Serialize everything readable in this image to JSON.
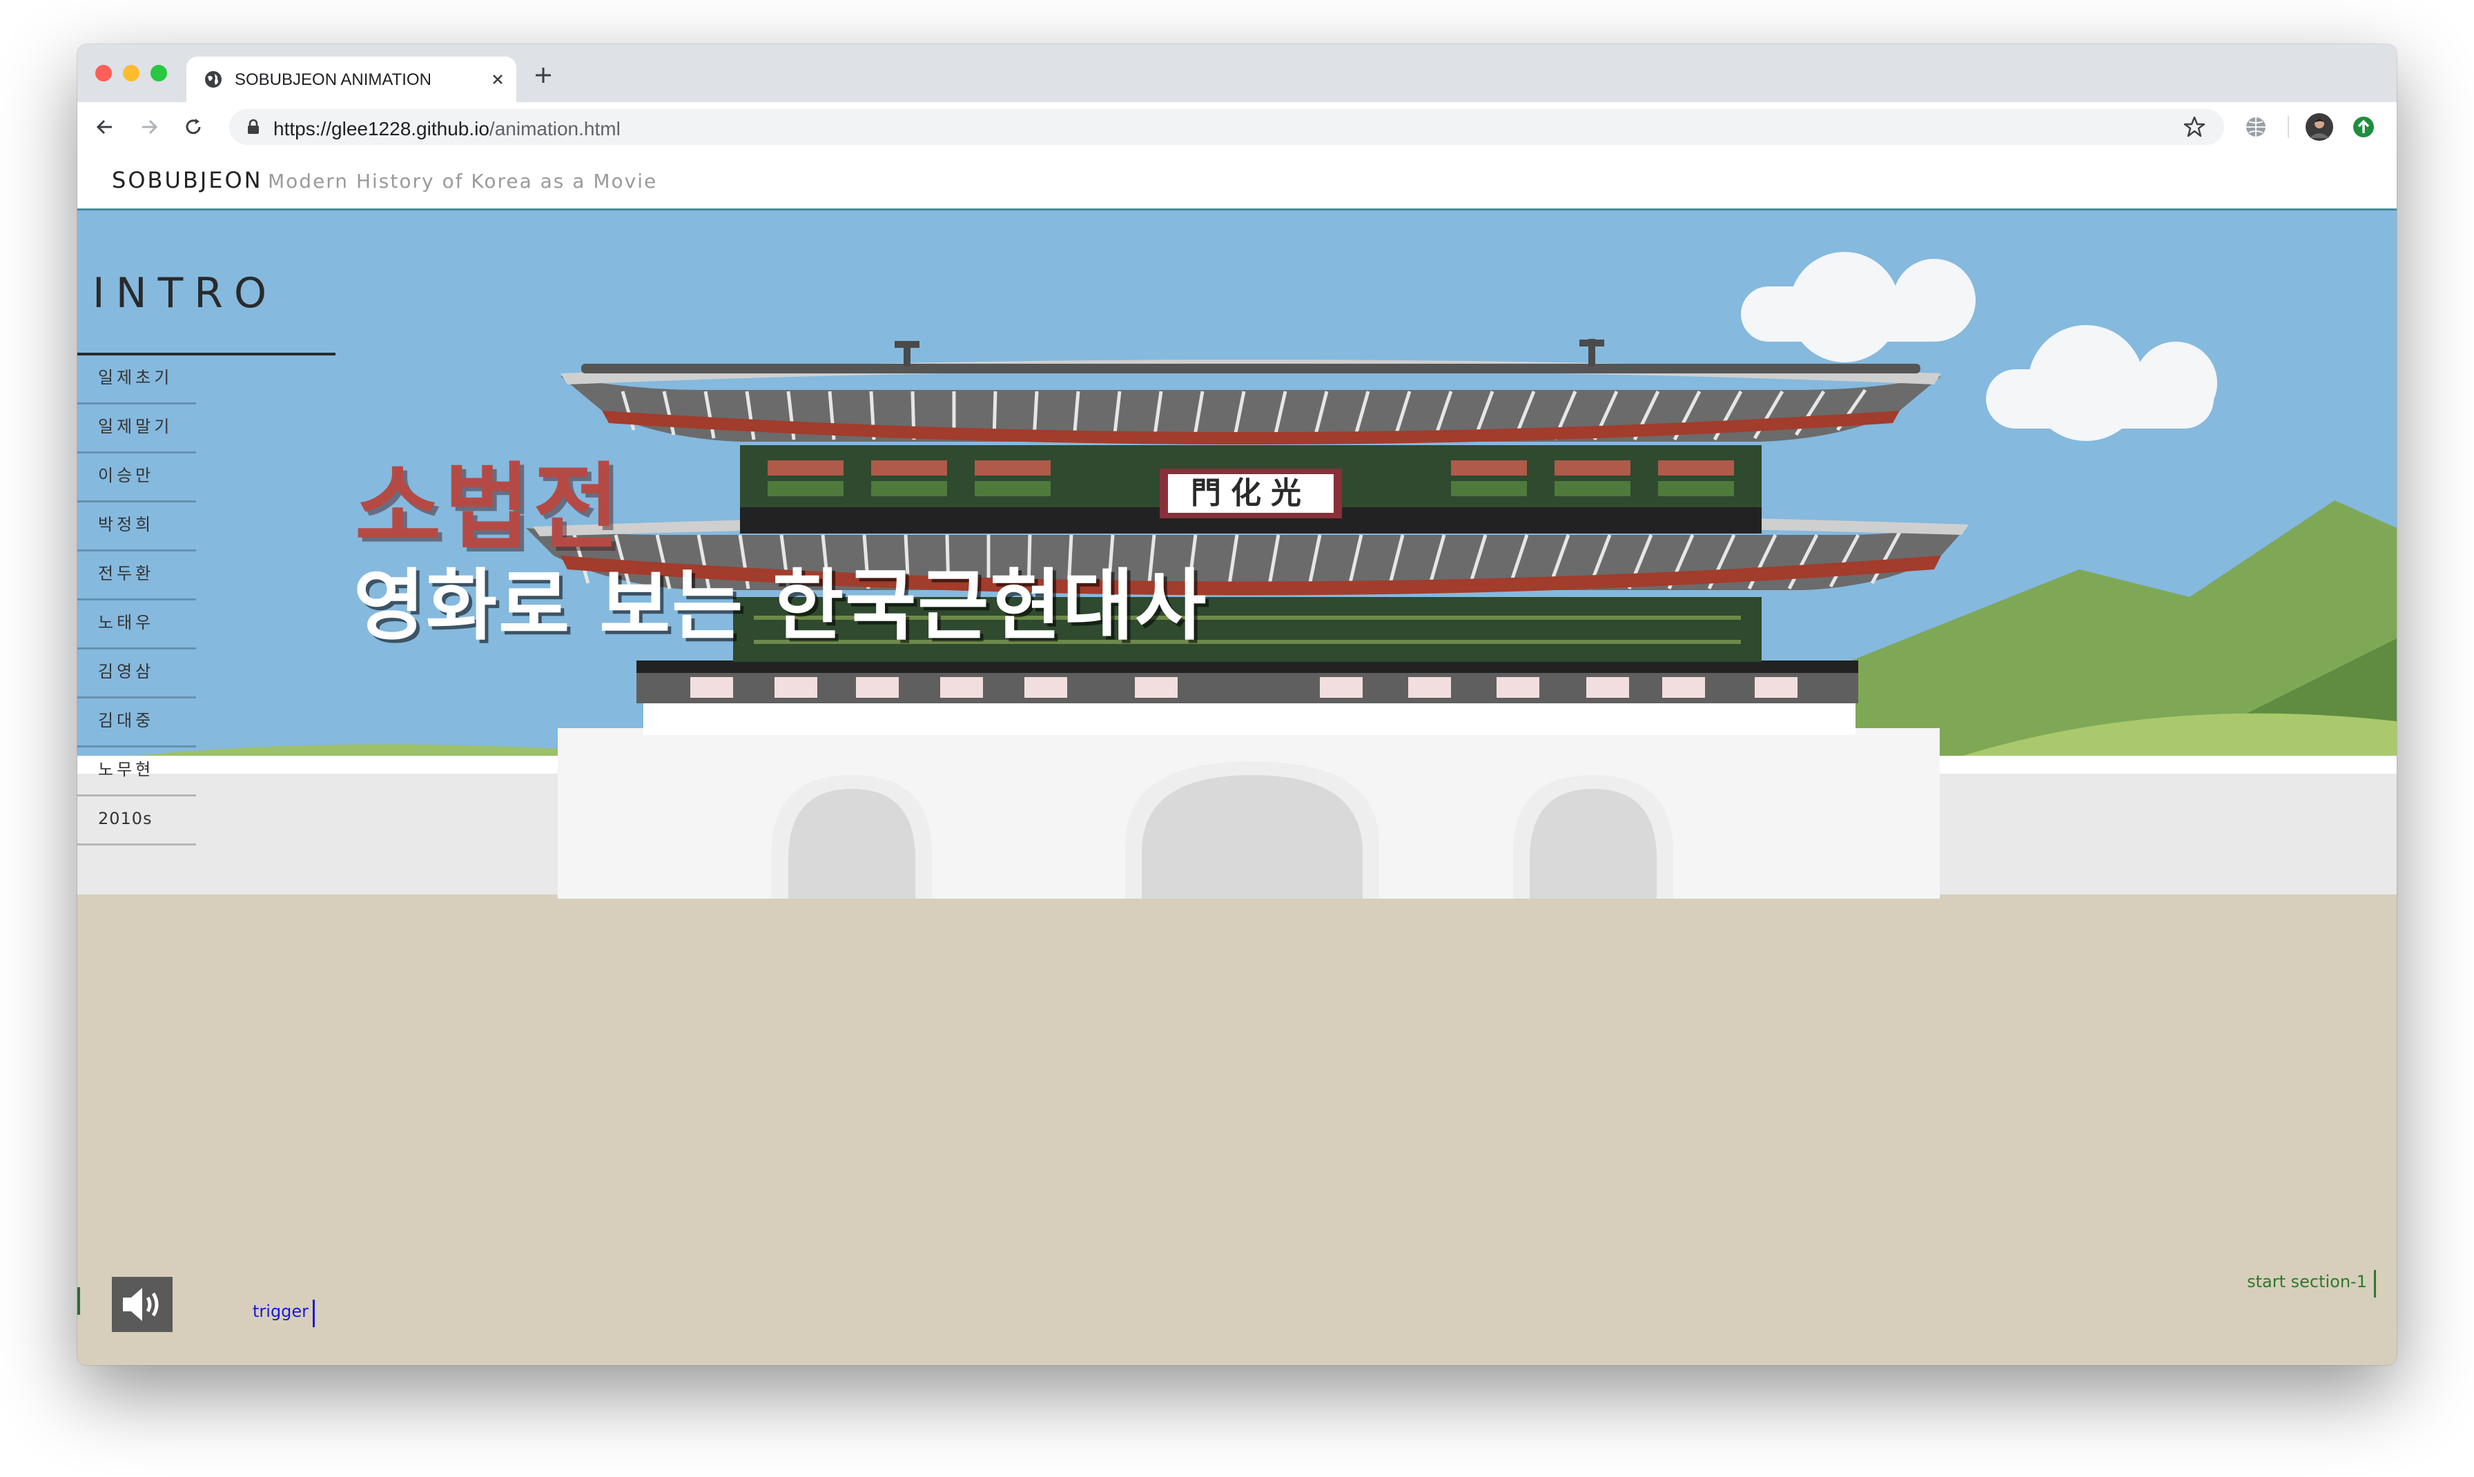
{
  "browser": {
    "tab_title": "SOBUBJEON ANIMATION",
    "url_host": "https://glee1228.github.io",
    "url_path": "/animation.html"
  },
  "site": {
    "brand": "SOBUBJEON",
    "tagline": "Modern History of Korea as a Movie"
  },
  "intro": {
    "title": "INTRO",
    "nav_items": [
      "일제초기",
      "일제말기",
      "이승만",
      "박정희",
      "전두환",
      "노태우",
      "김영삼",
      "김대중",
      "노무현",
      "2010s"
    ]
  },
  "hero": {
    "title": "소법전",
    "subtitle": "영화로 보는 한국근현대사"
  },
  "gate": {
    "signboard": "門化光"
  },
  "controls": {
    "trigger_label": "trigger",
    "start_label": "start section-1"
  },
  "icons": [
    "globe-icon",
    "close-icon",
    "plus-icon",
    "back-arrow-icon",
    "forward-arrow-icon",
    "reload-icon",
    "lock-icon",
    "star-icon",
    "web-icon",
    "avatar",
    "update-icon",
    "speaker-icon"
  ],
  "colors": {
    "sky": "#85b9de",
    "ground": "#d7cfbb",
    "hero_red": "#b54a45",
    "header_rule": "#4a8c9c",
    "trigger_blue": "#1a1ad6",
    "start_green": "#2c7a2c"
  }
}
